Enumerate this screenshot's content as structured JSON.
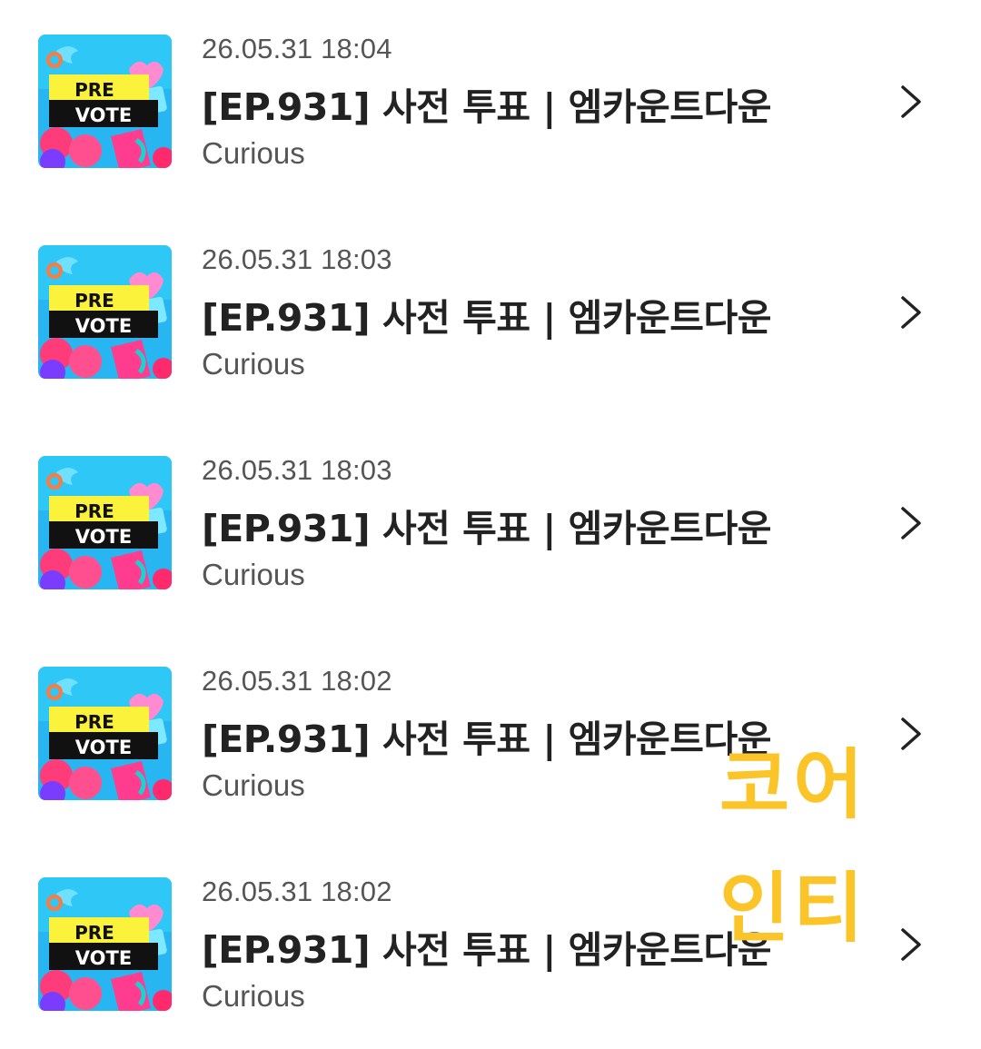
{
  "items": [
    {
      "date": "26.05.31 18:04",
      "title": "[EP.931] 사전 투표 | 엠카운트다운",
      "artist": "Curious",
      "thumb": {
        "line1": "PRE",
        "line2": "VOTE"
      }
    },
    {
      "date": "26.05.31 18:03",
      "title": "[EP.931] 사전 투표 | 엠카운트다운",
      "artist": "Curious",
      "thumb": {
        "line1": "PRE",
        "line2": "VOTE"
      }
    },
    {
      "date": "26.05.31 18:03",
      "title": "[EP.931] 사전 투표 | 엠카운트다운",
      "artist": "Curious",
      "thumb": {
        "line1": "PRE",
        "line2": "VOTE"
      }
    },
    {
      "date": "26.05.31 18:02",
      "title": "[EP.931] 사전 투표 | 엠카운트다운",
      "artist": "Curious",
      "thumb": {
        "line1": "PRE",
        "line2": "VOTE"
      }
    },
    {
      "date": "26.05.31 18:02",
      "title": "[EP.931] 사전 투표 | 엠카운트다운",
      "artist": "Curious",
      "thumb": {
        "line1": "PRE",
        "line2": "VOTE"
      }
    }
  ],
  "watermark": {
    "line1": "코어",
    "line2": "인티",
    "color": "#fbc52a"
  },
  "icons": {
    "row_action": "chevron-right-icon",
    "thumbnail": "pre-vote-thumbnail"
  }
}
